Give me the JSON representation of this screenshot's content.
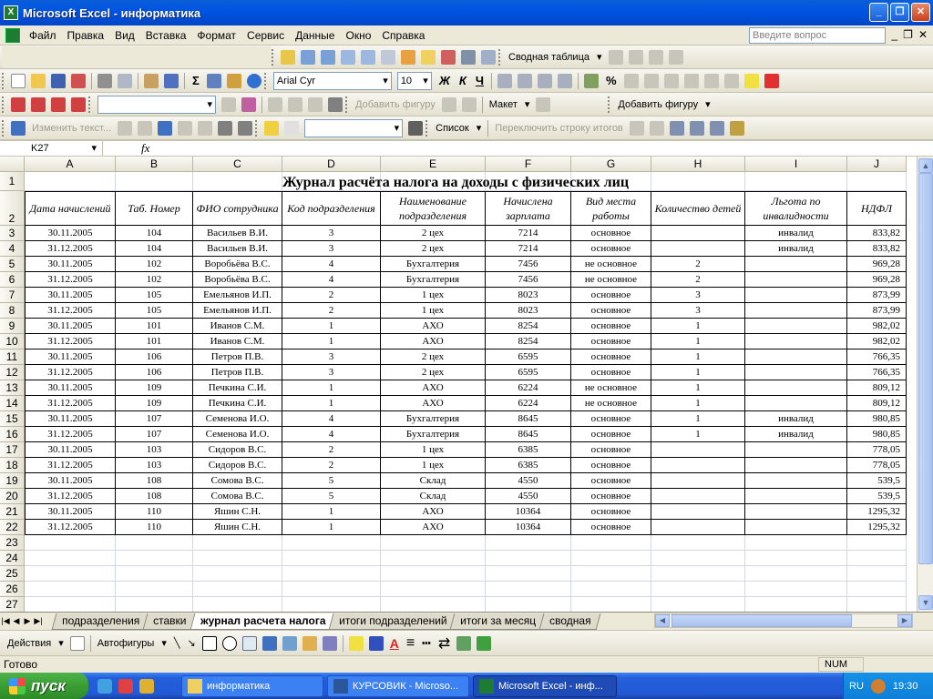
{
  "window": {
    "title": "Microsoft Excel - информатика",
    "app_icon_label": "X"
  },
  "menu": {
    "items": [
      "Файл",
      "Правка",
      "Вид",
      "Вставка",
      "Формат",
      "Сервис",
      "Данные",
      "Окно",
      "Справка"
    ],
    "help_placeholder": "Введите вопрос"
  },
  "toolbars": {
    "pivot_label": "Сводная таблица",
    "font_name": "Arial Cyr",
    "font_size": "10",
    "bold": "Ж",
    "italic": "К",
    "underline": "Ч",
    "add_shape": "Добавить фигуру",
    "layout": "Макет",
    "add_shape2": "Добавить фигуру",
    "edit_text": "Изменить текст...",
    "list": "Список",
    "toggle_total": "Переключить строку итогов"
  },
  "formula_bar": {
    "cell_ref": "K27",
    "fx": "fx",
    "formula": ""
  },
  "sheet": {
    "columns": [
      "A",
      "B",
      "C",
      "D",
      "E",
      "F",
      "G",
      "H",
      "I",
      "J"
    ],
    "title": "Журнал расчёта налога на доходы с физических лиц",
    "headers": [
      "Дата начислений",
      "Таб. Номер",
      "ФИО сотрудника",
      "Код подразделения",
      "Наименование подразделения",
      "Начислена зарплата",
      "Вид места работы",
      "Количество детей",
      "Льгота по инвалидности",
      "НДФЛ"
    ],
    "rows": [
      [
        "30.11.2005",
        "104",
        "Васильев В.И.",
        "3",
        "2 цех",
        "7214",
        "основное",
        "",
        "инвалид",
        "833,82"
      ],
      [
        "31.12.2005",
        "104",
        "Васильев В.И.",
        "3",
        "2 цех",
        "7214",
        "основное",
        "",
        "инвалид",
        "833,82"
      ],
      [
        "30.11.2005",
        "102",
        "Воробьёва В.С.",
        "4",
        "Бухгалтерия",
        "7456",
        "не основное",
        "2",
        "",
        "969,28"
      ],
      [
        "31.12.2005",
        "102",
        "Воробьёва В.С.",
        "4",
        "Бухгалтерия",
        "7456",
        "не основное",
        "2",
        "",
        "969,28"
      ],
      [
        "30.11.2005",
        "105",
        "Емельянов И.П.",
        "2",
        "1 цех",
        "8023",
        "основное",
        "3",
        "",
        "873,99"
      ],
      [
        "31.12.2005",
        "105",
        "Емельянов И.П.",
        "2",
        "1 цех",
        "8023",
        "основное",
        "3",
        "",
        "873,99"
      ],
      [
        "30.11.2005",
        "101",
        "Иванов С.М.",
        "1",
        "АХО",
        "8254",
        "основное",
        "1",
        "",
        "982,02"
      ],
      [
        "31.12.2005",
        "101",
        "Иванов С.М.",
        "1",
        "АХО",
        "8254",
        "основное",
        "1",
        "",
        "982,02"
      ],
      [
        "30.11.2005",
        "106",
        "Петров П.В.",
        "3",
        "2 цех",
        "6595",
        "основное",
        "1",
        "",
        "766,35"
      ],
      [
        "31.12.2005",
        "106",
        "Петров П.В.",
        "3",
        "2 цех",
        "6595",
        "основное",
        "1",
        "",
        "766,35"
      ],
      [
        "30.11.2005",
        "109",
        "Печкина С.И.",
        "1",
        "АХО",
        "6224",
        "не основное",
        "1",
        "",
        "809,12"
      ],
      [
        "31.12.2005",
        "109",
        "Печкина С.И.",
        "1",
        "АХО",
        "6224",
        "не основное",
        "1",
        "",
        "809,12"
      ],
      [
        "30.11.2005",
        "107",
        "Семенова И.О.",
        "4",
        "Бухгалтерия",
        "8645",
        "основное",
        "1",
        "инвалид",
        "980,85"
      ],
      [
        "31.12.2005",
        "107",
        "Семенова И.О.",
        "4",
        "Бухгалтерия",
        "8645",
        "основное",
        "1",
        "инвалид",
        "980,85"
      ],
      [
        "30.11.2005",
        "103",
        "Сидоров В.С.",
        "2",
        "1 цех",
        "6385",
        "основное",
        "",
        "",
        "778,05"
      ],
      [
        "31.12.2005",
        "103",
        "Сидоров В.С.",
        "2",
        "1 цех",
        "6385",
        "основное",
        "",
        "",
        "778,05"
      ],
      [
        "30.11.2005",
        "108",
        "Сомова В.С.",
        "5",
        "Склад",
        "4550",
        "основное",
        "",
        "",
        "539,5"
      ],
      [
        "31.12.2005",
        "108",
        "Сомова В.С.",
        "5",
        "Склад",
        "4550",
        "основное",
        "",
        "",
        "539,5"
      ],
      [
        "30.11.2005",
        "110",
        "Яшин С.Н.",
        "1",
        "АХО",
        "10364",
        "основное",
        "",
        "",
        "1295,32"
      ],
      [
        "31.12.2005",
        "110",
        "Яшин С.Н.",
        "1",
        "АХО",
        "10364",
        "основное",
        "",
        "",
        "1295,32"
      ]
    ],
    "row_numbers": [
      "1",
      "2",
      "3",
      "4",
      "5",
      "6",
      "7",
      "8",
      "9",
      "10",
      "11",
      "12",
      "13",
      "14",
      "15",
      "16",
      "17",
      "18",
      "19",
      "20",
      "21",
      "22",
      "23",
      "24",
      "25",
      "26",
      "27"
    ]
  },
  "tabs": {
    "items": [
      "подразделения",
      "ставки",
      "журнал расчета налога",
      "итоги подразделений",
      "итоги за месяц",
      "сводная"
    ],
    "active_index": 2
  },
  "draw_toolbar": {
    "actions": "Действия",
    "autoshapes": "Автофигуры"
  },
  "status": {
    "text": "Готово",
    "num": "NUM"
  },
  "taskbar": {
    "start": "пуск",
    "tasks": [
      "информатика",
      "КУРСОВИК - Microso...",
      "Microsoft Excel - инф..."
    ],
    "lang": "RU",
    "clock": "19:30"
  },
  "colors": {
    "title_bar": "#0054e3",
    "excel_green": "#1e7b34",
    "taskbar": "#245edb",
    "start": "#379a31"
  }
}
